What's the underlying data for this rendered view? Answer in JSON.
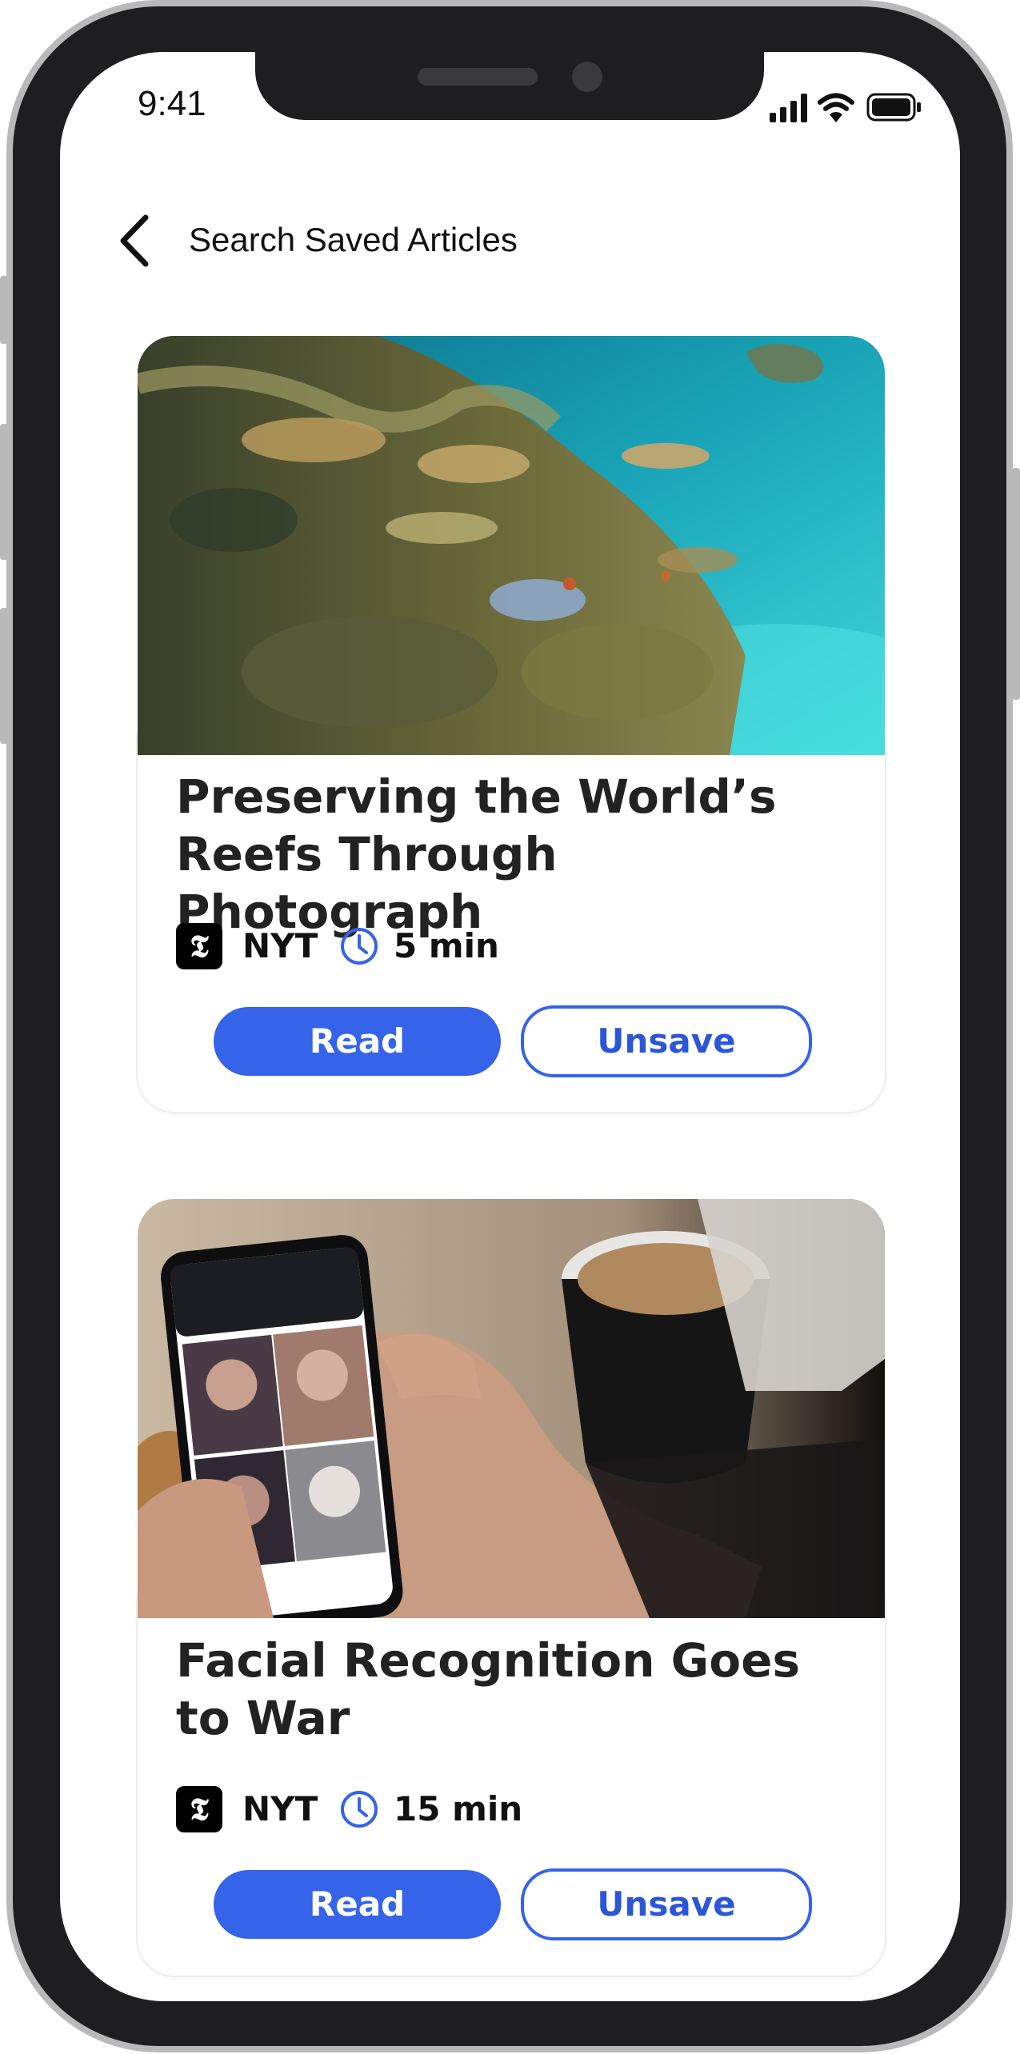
{
  "status_bar": {
    "time": "9:41"
  },
  "header": {
    "title": "Search Saved Articles"
  },
  "colors": {
    "accent": "#3563ea",
    "text": "#222222"
  },
  "articles": [
    {
      "title": "Preserving the World’s Reefs Through Photograph",
      "source": "NYT",
      "source_logo": "𝕿",
      "read_time": "5 min",
      "read_label": "Read",
      "unsave_label": "Unsave",
      "image": "coral-reef-photo"
    },
    {
      "title": "Facial Recognition Goes to War",
      "source": "NYT",
      "source_logo": "𝕿",
      "read_time": "15 min",
      "read_label": "Read",
      "unsave_label": "Unsave",
      "image": "phone-face-search-photo"
    }
  ]
}
